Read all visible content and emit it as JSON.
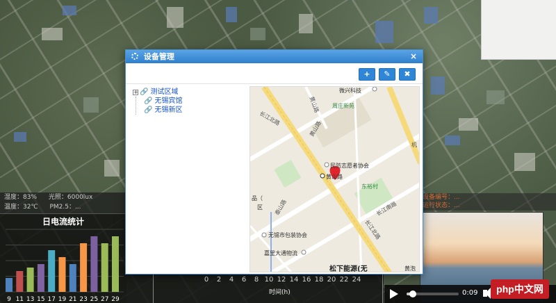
{
  "dialog": {
    "title": "设备管理",
    "close": "×",
    "toolbar": {
      "add": "+",
      "edit": "✎",
      "delete": "✖"
    }
  },
  "tree": {
    "root": {
      "label": "测试区域",
      "expander": "+"
    },
    "children": [
      "无锡宾馆",
      "无锡新区"
    ]
  },
  "map": {
    "labels": {
      "poi_top": "微兴科技",
      "poi_area": "周庄新苑",
      "poi_assoc": "民防志愿者协会",
      "marker_road": "黄山路",
      "village": "东裕村",
      "pack_assoc": "无锡市包装协会",
      "logistics": "嘉里大通物流",
      "energy": "松下能源(无",
      "road_1": "长江北路",
      "road_2": "黄山路",
      "road_3": "黄山路",
      "road_4": "泰山路",
      "road_5": "长江北路",
      "road_6": "长江南路",
      "road_7": "机",
      "misc_1": "品（",
      "misc_2": "区",
      "misc_3": "黄泡"
    },
    "colors": {
      "main_road": "#f5d97a",
      "road": "#ffffff",
      "park": "#cfe8c3",
      "marker": "#e0262c"
    }
  },
  "stats": {
    "row1": [
      "湿度：83%",
      "光照：6000lux"
    ],
    "row2": [
      "温度：32℃",
      "PM2.5：..."
    ]
  },
  "chart_data": {
    "type": "bar",
    "title": "日电流统计",
    "categories": [
      "9",
      "11",
      "13",
      "15",
      "17",
      "19",
      "21",
      "23",
      "25",
      "27",
      "29"
    ],
    "values": [
      2,
      3,
      3.5,
      4,
      6,
      5,
      4,
      7,
      8,
      7,
      8
    ],
    "colors": [
      "#4f81bd",
      "#c0504d",
      "#9bbb59",
      "#8064a2",
      "#4bacc6",
      "#f79646",
      "#4f81bd",
      "#f79646",
      "#7d60a0",
      "#9bbb59",
      "#9bbb59"
    ]
  },
  "time_axis": {
    "ticks": [
      "0",
      "2",
      "4",
      "6",
      "8",
      "10",
      "12",
      "14",
      "16",
      "18",
      "20",
      "22",
      "24"
    ],
    "label": "时间(h)"
  },
  "right_strip": {
    "line1": "设备编号：...",
    "line2": "运行状态：..."
  },
  "video": {
    "time": "0:09"
  },
  "watermark": "php中文网"
}
